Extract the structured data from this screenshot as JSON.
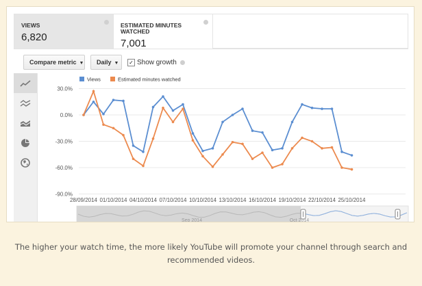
{
  "metrics": [
    {
      "label": "Views",
      "value": "6,820"
    },
    {
      "label": "Estimated minutes watched",
      "value": "7,001"
    }
  ],
  "toolbar": {
    "compare_label": "Compare metric",
    "interval_label": "Daily",
    "show_growth_label": "Show growth",
    "show_growth_checked": true
  },
  "chart_types": [
    "line-chart-icon",
    "multi-line-chart-icon",
    "stacked-area-icon",
    "pie-chart-icon",
    "globe-icon"
  ],
  "colors": {
    "views": "#5b8ed1",
    "minutes": "#ec8a4e"
  },
  "chart_data": {
    "type": "line",
    "ylabel_format": "percent",
    "ylim": [
      -90,
      30
    ],
    "yticks": [
      "30.0%",
      "0.0%",
      "-30.0%",
      "-60.0%",
      "-90.0%"
    ],
    "x": [
      "28/09/2014",
      "29/09/2014",
      "30/09/2014",
      "01/10/2014",
      "02/10/2014",
      "03/10/2014",
      "04/10/2014",
      "05/10/2014",
      "06/10/2014",
      "07/10/2014",
      "08/10/2014",
      "09/10/2014",
      "10/10/2014",
      "11/10/2014",
      "12/10/2014",
      "13/10/2014",
      "14/10/2014",
      "15/10/2014",
      "16/10/2014",
      "17/10/2014",
      "18/10/2014",
      "19/10/2014",
      "20/10/2014",
      "21/10/2014",
      "22/10/2014",
      "23/10/2014",
      "24/10/2014",
      "25/10/2014",
      "26/10/2014"
    ],
    "xticks": [
      "28/09/2014",
      "01/10/2014",
      "04/10/2014",
      "07/10/2014",
      "10/10/2014",
      "13/10/2014",
      "16/10/2014",
      "19/10/2014",
      "22/10/2014",
      "25/10/2014"
    ],
    "series": [
      {
        "name": "Views",
        "values": [
          0,
          15,
          1,
          17,
          16,
          -35,
          -42,
          9,
          21,
          5,
          12,
          -21,
          -41,
          -38,
          -8,
          0,
          7,
          -18,
          -20,
          -40,
          -38,
          -8,
          12,
          8,
          7,
          7,
          -42,
          -46
        ]
      },
      {
        "name": "Estimated minutes watched",
        "values": [
          0,
          27,
          -11,
          -15,
          -23,
          -50,
          -58,
          -27,
          8,
          -8,
          7,
          -29,
          -47,
          -59,
          -45,
          -31,
          -33,
          -50,
          -43,
          -60,
          -56,
          -38,
          -26,
          -30,
          -38,
          -37,
          -60,
          -62
        ]
      }
    ],
    "legend_position": "top-left",
    "grid": true
  },
  "timeline": {
    "left_label": "Sep 2014",
    "right_label": "Oct 2014"
  },
  "caption": "The higher your watch time, the more likely YouTube will promote your channel through search and recommended videos."
}
